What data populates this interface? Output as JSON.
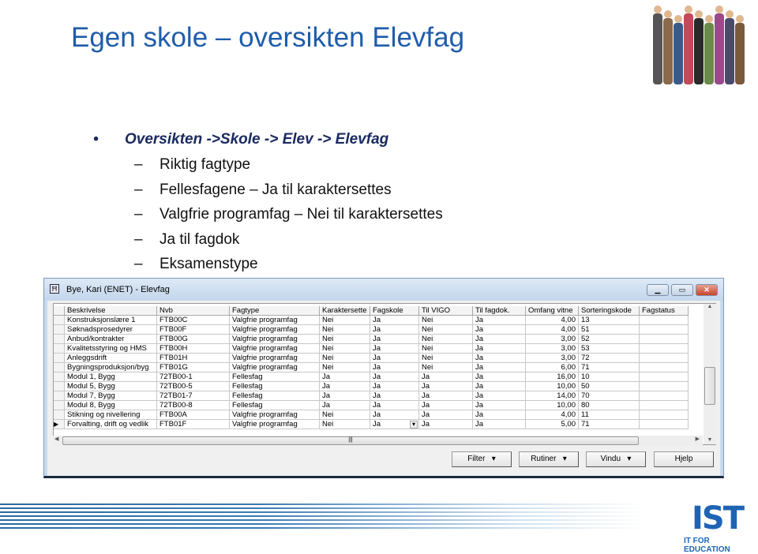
{
  "slide": {
    "title": "Egen skole – oversikten Elevfag",
    "bullet": "Oversikten ->Skole -> Elev -> Elevfag",
    "sub_items": [
      "Riktig fagtype",
      "Fellesfagene – Ja til karaktersettes",
      "Valgfrie programfag – Nei til karaktersettes",
      "Ja til fagdok",
      "Eksamenstype"
    ]
  },
  "window": {
    "title": "Bye, Kari (ENET) - Elevfag",
    "icon": "app-icon",
    "columns": [
      "Beskrivelse",
      "Nvb",
      "Fagtype",
      "Karaktersette",
      "Fagskole",
      "Til VIGO",
      "Til fagdok.",
      "Omfang vitne",
      "Sorteringskode",
      "Fagstatus"
    ],
    "rows": [
      [
        "Konstruksjonslære 1",
        "FTB00C",
        "Valgfrie programfag",
        "Nei",
        "Ja",
        "Nei",
        "Ja",
        "4,00",
        "13",
        ""
      ],
      [
        "Søknadsprosedyrer",
        "FTB00F",
        "Valgfrie programfag",
        "Nei",
        "Ja",
        "Nei",
        "Ja",
        "4,00",
        "51",
        ""
      ],
      [
        "Anbud/kontrakter",
        "FTB00G",
        "Valgfrie programfag",
        "Nei",
        "Ja",
        "Nei",
        "Ja",
        "3,00",
        "52",
        ""
      ],
      [
        "Kvalitetsstyring og HMS",
        "FTB00H",
        "Valgfrie programfag",
        "Nei",
        "Ja",
        "Nei",
        "Ja",
        "3,00",
        "53",
        ""
      ],
      [
        "Anleggsdrift",
        "FTB01H",
        "Valgfrie programfag",
        "Nei",
        "Ja",
        "Nei",
        "Ja",
        "3,00",
        "72",
        ""
      ],
      [
        "Bygningsproduksjon/byg",
        "FTB01G",
        "Valgfrie programfag",
        "Nei",
        "Ja",
        "Nei",
        "Ja",
        "6,00",
        "71",
        ""
      ],
      [
        "Modul 1, Bygg",
        "72TB00-1",
        "Fellesfag",
        "Ja",
        "Ja",
        "Ja",
        "Ja",
        "16,00",
        "10",
        ""
      ],
      [
        "Modul 5, Bygg",
        "72TB00-5",
        "Fellesfag",
        "Ja",
        "Ja",
        "Ja",
        "Ja",
        "10,00",
        "50",
        ""
      ],
      [
        "Modul 7, Bygg",
        "72TB01-7",
        "Fellesfag",
        "Ja",
        "Ja",
        "Ja",
        "Ja",
        "14,00",
        "70",
        ""
      ],
      [
        "Modul 8, Bygg",
        "72TB00-8",
        "Fellesfag",
        "Ja",
        "Ja",
        "Ja",
        "Ja",
        "10,00",
        "80",
        ""
      ],
      [
        "Stikning og nivellering",
        "FTB00A",
        "Valgfrie programfag",
        "Nei",
        "Ja",
        "Ja",
        "Ja",
        "4,00",
        "11",
        ""
      ],
      [
        "Forvalting, drift og vedlik",
        "FTB01F",
        "Valgfrie programfag",
        "Nei",
        "Ja",
        "Ja",
        "Ja",
        "5,00",
        "71",
        ""
      ]
    ],
    "current_row": 11,
    "buttons": {
      "filter": "Filter",
      "rutiner": "Rutiner",
      "vindu": "Vindu",
      "hjelp": "Hjelp"
    }
  },
  "footer": {
    "logo": "IST",
    "tagline": "IT FOR EDUCATION"
  }
}
